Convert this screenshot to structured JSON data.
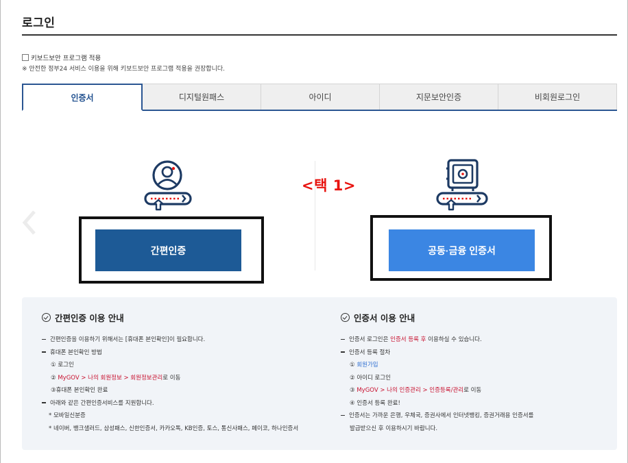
{
  "header": {
    "title": "로그인"
  },
  "keyboard_security": {
    "checkbox_label": "키보드보안 프로그램 적용",
    "note": "※ 안전한 정부24 서비스 이용을 위해 키보드보안 프로그램 적용을 권장합니다."
  },
  "tabs": [
    {
      "label": "인증서",
      "active": true
    },
    {
      "label": "디지털원패스",
      "active": false
    },
    {
      "label": "아이디",
      "active": false
    },
    {
      "label": "지문보안인증",
      "active": false
    },
    {
      "label": "비회원로그인",
      "active": false
    }
  ],
  "login_options": {
    "simple_auth_button": "간편인증",
    "certificate_button": "공동·금융 인증서"
  },
  "annotation": {
    "label": "<택 1>",
    "color": "#e8130f"
  },
  "guide_left": {
    "title": "간편인증 이용 안내",
    "lines": {
      "l1": "간편인증을 이용하기 위해서는 [휴대폰 본인확인]이 필요합니다.",
      "l2": "휴대폰 본인확인 방법",
      "l3": "① 로그인",
      "l4a": "② ",
      "l4b": "MyGOV > 나의 회원정보 > 회원정보관리",
      "l4c": "로 이동",
      "l5": "③휴대폰 본인확인 완료",
      "l6": "아래와 같은 간편인증서비스를 지원합니다.",
      "l7": "* 모바일신분증",
      "l8": "* 네이버, 뱅크샐러드, 삼성패스, 신한인증서, 카카오톡, KB인증, 토스, 통신사패스, 페이코, 하나인증서"
    }
  },
  "guide_right": {
    "title": "인증서 이용 안내",
    "lines": {
      "r1a": "인증서 로그인은 ",
      "r1b": "인증서 등록 후",
      "r1c": " 이용하실 수 있습니다.",
      "r2": "인증서 등록 절차",
      "r3a": "① ",
      "r3b": "회원가입",
      "r4": "② 아이디 로그인",
      "r5a": "③ ",
      "r5b": "MyGOV > 나의 인증관리 > 인증등록/관리",
      "r5c": "로 이동",
      "r6": "④ 인증서 등록 완료!",
      "r7": "인증서는 가까운 은행, 우체국, 증권사에서 인터넷뱅킹, 증권거래용 인증서를",
      "r8": "발급받으신 후 이용하시기 바랍니다."
    }
  },
  "colors": {
    "primary_dark": "#1d5a96",
    "primary_light": "#3b86e3",
    "highlight_red": "#c8102e",
    "link_blue": "#2f6fd1"
  }
}
